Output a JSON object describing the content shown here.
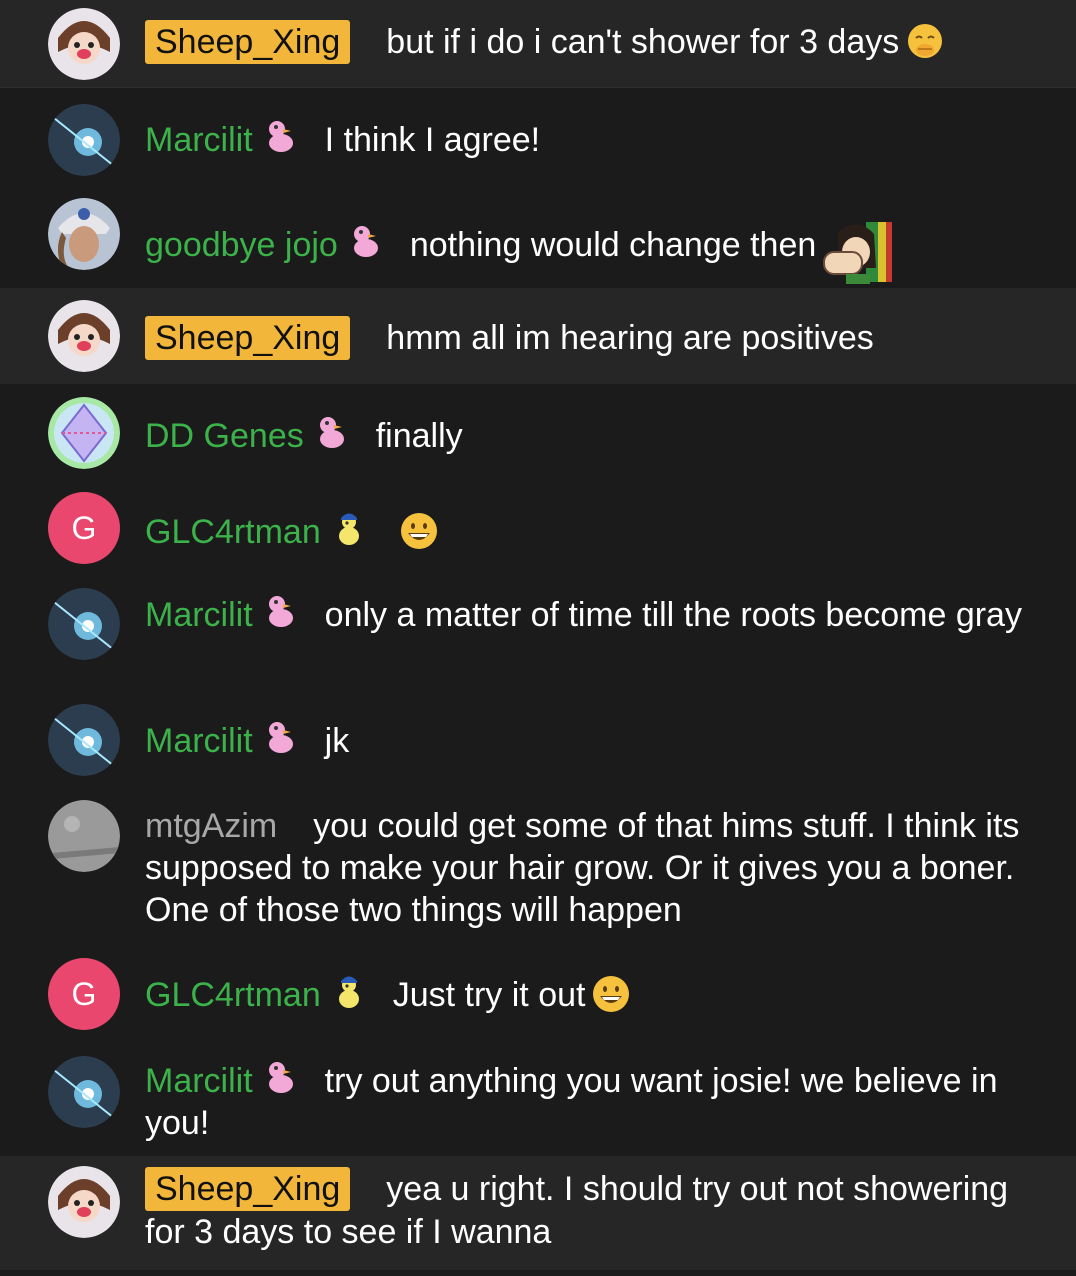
{
  "colors": {
    "background": "#1b1b1b",
    "highlight_row": "#262626",
    "username_green": "#3bb24a",
    "username_gray": "#a8a8a8",
    "owner_badge": "#f2b63a",
    "letter_avatar": "#e9476e"
  },
  "messages": [
    {
      "user": "Sheep_Xing",
      "text": "but if i do i can't shower for 3 days",
      "emoji": "shushing-face-emoji"
    },
    {
      "user": "Marcilit",
      "badge": "pink-duck-badge-icon",
      "text": "I think I agree!"
    },
    {
      "user": "goodbye jojo",
      "badge": "pink-duck-badge-icon",
      "text": "nothing would change then",
      "emoji": "custom-emote-sticker"
    },
    {
      "user": "Sheep_Xing",
      "text": "hmm all im hearing are positives"
    },
    {
      "user": "DD Genes",
      "badge": "pink-duck-badge-icon",
      "text": "finally"
    },
    {
      "user": "GLC4rtman",
      "avatar_letter": "G",
      "badge": "yellow-duck-badge-icon",
      "text": "",
      "emoji": "grinning-face-emoji"
    },
    {
      "user": "Marcilit",
      "badge": "pink-duck-badge-icon",
      "text": "only a matter of time till the roots become gray"
    },
    {
      "user": "Marcilit",
      "badge": "pink-duck-badge-icon",
      "text": "jk"
    },
    {
      "user": "mtgAzim",
      "text": "you could get some of that hims stuff. I think its supposed to make your hair grow. Or it gives you a boner. One of those two things will happen"
    },
    {
      "user": "GLC4rtman",
      "avatar_letter": "G",
      "badge": "yellow-duck-badge-icon",
      "text": "Just try it out",
      "emoji": "grinning-face-emoji"
    },
    {
      "user": "Marcilit",
      "badge": "pink-duck-badge-icon",
      "text": "try out anything you want josie! we believe in you!"
    },
    {
      "user": "Sheep_Xing",
      "text": "yea u right. I should try out not showering for 3 days to see if I wanna"
    }
  ]
}
